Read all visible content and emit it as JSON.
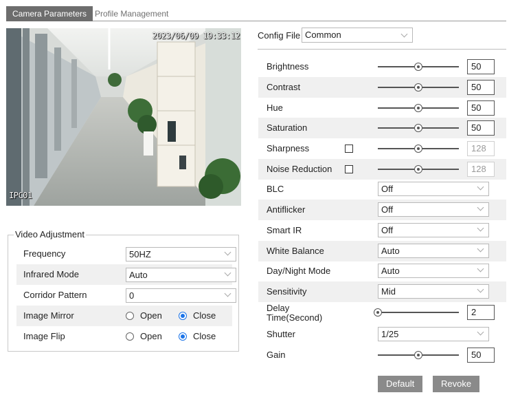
{
  "tabs": {
    "active": "Camera Parameters",
    "inactive": "Profile Management"
  },
  "preview": {
    "timestamp": "2023/06/09 19:33:12",
    "camera_name": "IPC01"
  },
  "video_adjustment": {
    "legend": "Video Adjustment",
    "frequency": {
      "label": "Frequency",
      "value": "50HZ"
    },
    "infrared_mode": {
      "label": "Infrared Mode",
      "value": "Auto"
    },
    "corridor_pattern": {
      "label": "Corridor Pattern",
      "value": "0"
    },
    "image_mirror": {
      "label": "Image Mirror",
      "open": "Open",
      "close": "Close",
      "selected": "Close"
    },
    "image_flip": {
      "label": "Image Flip",
      "open": "Open",
      "close": "Close",
      "selected": "Close"
    }
  },
  "config_file": {
    "label": "Config File",
    "value": "Common"
  },
  "params": {
    "brightness": {
      "label": "Brightness",
      "value": "50",
      "level": 0.5
    },
    "contrast": {
      "label": "Contrast",
      "value": "50",
      "level": 0.5
    },
    "hue": {
      "label": "Hue",
      "value": "50",
      "level": 0.5
    },
    "saturation": {
      "label": "Saturation",
      "value": "50",
      "level": 0.5
    },
    "sharpness": {
      "label": "Sharpness",
      "value": "128",
      "level": 0.5,
      "checked": false
    },
    "noise_reduction": {
      "label": "Noise Reduction",
      "value": "128",
      "level": 0.5,
      "checked": false
    },
    "blc": {
      "label": "BLC",
      "value": "Off"
    },
    "antiflicker": {
      "label": "Antiflicker",
      "value": "Off"
    },
    "smart_ir": {
      "label": "Smart IR",
      "value": "Off"
    },
    "white_balance": {
      "label": "White Balance",
      "value": "Auto"
    },
    "day_night_mode": {
      "label": "Day/Night Mode",
      "value": "Auto"
    },
    "sensitivity": {
      "label": "Sensitivity",
      "value": "Mid"
    },
    "delay_time": {
      "label_line1": "Delay",
      "label_line2": "Time(Second)",
      "value": "2",
      "level": 0.0
    },
    "shutter": {
      "label": "Shutter",
      "value": "1/25"
    },
    "gain": {
      "label": "Gain",
      "value": "50",
      "level": 0.5
    }
  },
  "buttons": {
    "default": "Default",
    "revoke": "Revoke"
  },
  "colors": {
    "tab_active_bg": "#6d6d6d",
    "button_bg": "#8a8a8a",
    "radio_selected": "#1a73e8",
    "row_shade": "#f0f0f0"
  }
}
